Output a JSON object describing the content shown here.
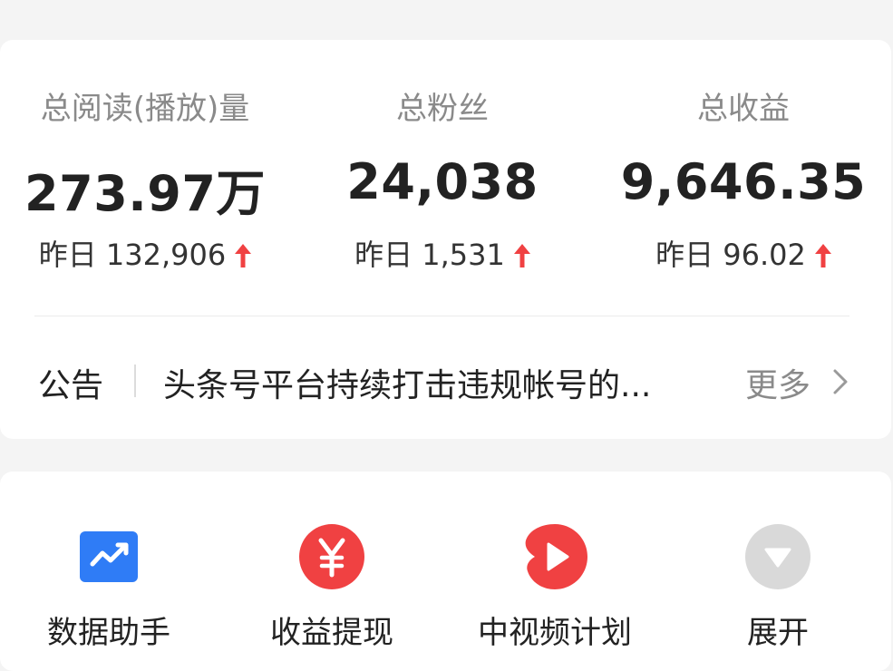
{
  "stats": [
    {
      "label": "总阅读(播放)量",
      "value": "273.97万",
      "yesterday": "昨日 132,906"
    },
    {
      "label": "总粉丝",
      "value": "24,038",
      "yesterday": "昨日 1,531"
    },
    {
      "label": "总收益",
      "value": "9,646.35",
      "yesterday": "昨日 96.02"
    }
  ],
  "notice": {
    "label": "公告",
    "text": "头条号平台持续打击违规帐号的...",
    "more": "更多"
  },
  "tools": [
    {
      "label": "数据助手",
      "icon": "chart-icon",
      "color": "#2f7cf6"
    },
    {
      "label": "收益提现",
      "icon": "yuan-icon",
      "color": "#f04142"
    },
    {
      "label": "中视频计划",
      "icon": "play-icon",
      "color": "#f04142"
    },
    {
      "label": "展开",
      "icon": "expand-icon",
      "color": "#d9d9d9"
    }
  ],
  "colors": {
    "up_arrow": "#f04142",
    "muted_text": "#8a8a8a"
  }
}
